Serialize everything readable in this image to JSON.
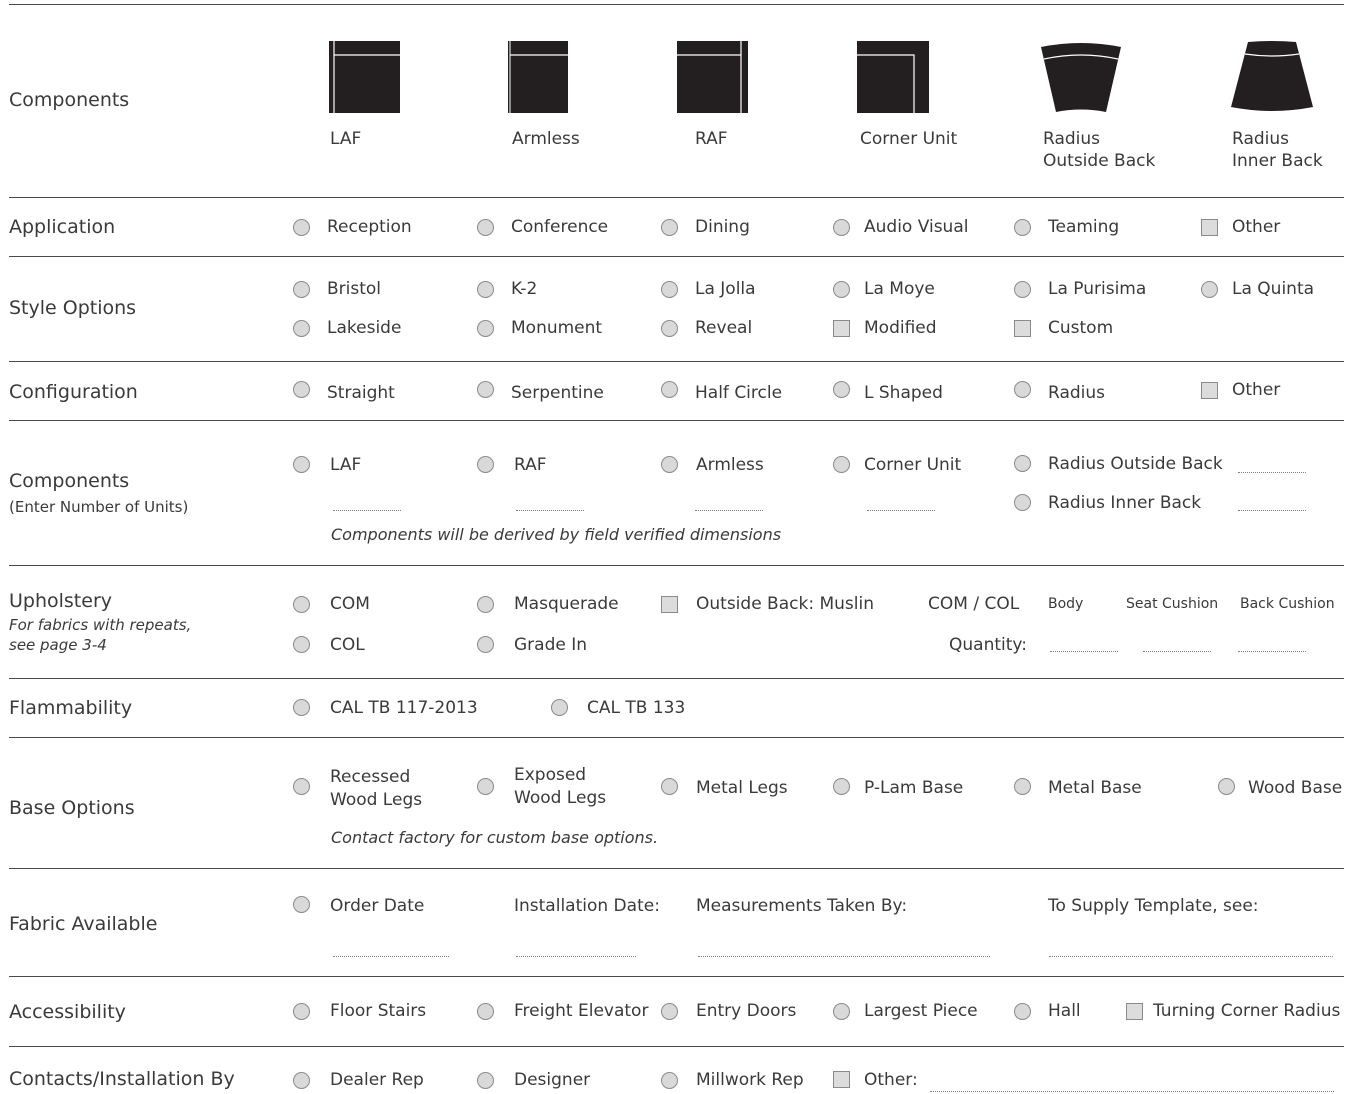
{
  "components_header": {
    "title": "Components",
    "items": [
      {
        "name": "LAF",
        "icon": "laf-icon"
      },
      {
        "name": "Armless",
        "icon": "armless-icon"
      },
      {
        "name": "RAF",
        "icon": "raf-icon"
      },
      {
        "name": "Corner Unit",
        "icon": "corner-unit-icon"
      },
      {
        "name_line1": "Radius",
        "name_line2": "Outside Back",
        "icon": "radius-outside-back-icon"
      },
      {
        "name_line1": "Radius",
        "name_line2": "Inner Back",
        "icon": "radius-inner-back-icon"
      }
    ]
  },
  "application": {
    "label": "Application",
    "options": [
      "Reception",
      "Conference",
      "Dining",
      "Audio Visual",
      "Teaming",
      "Other"
    ]
  },
  "style_options": {
    "label": "Style Options",
    "row1": [
      "Bristol",
      "K-2",
      "La Jolla",
      "La Moye",
      "La Purisima",
      "La Quinta"
    ],
    "row2": [
      "Lakeside",
      "Monument",
      "Reveal",
      "Modified",
      "Custom"
    ]
  },
  "configuration": {
    "label": "Configuration",
    "options": [
      "Straight",
      "Serpentine",
      "Half Circle",
      "L Shaped",
      "Radius",
      "Other"
    ]
  },
  "components_units": {
    "label": "Components",
    "sublabel": "(Enter Number of Units)",
    "options": [
      "LAF",
      "RAF",
      "Armless",
      "Corner Unit",
      "Radius Outside Back",
      "Radius Inner Back"
    ],
    "note": "Components will be derived by field verified dimensions"
  },
  "upholstery": {
    "label": "Upholstery",
    "note_line1": "For fabrics with repeats,",
    "note_line2": "see page 3-4",
    "options": [
      "COM",
      "Masquerade",
      "Outside Back: Muslin",
      "COL",
      "Grade In"
    ],
    "com_col": "COM / COL",
    "quantity": "Quantity:",
    "columns": [
      "Body",
      "Seat Cushion",
      "Back Cushion"
    ]
  },
  "flammability": {
    "label": "Flammability",
    "options": [
      "CAL TB 117-2013",
      "CAL TB 133"
    ]
  },
  "base_options": {
    "label": "Base Options",
    "recessed_line1": "Recessed",
    "recessed_line2": "Wood Legs",
    "exposed_line1": "Exposed",
    "exposed_line2": "Wood Legs",
    "options": [
      "Metal Legs",
      "P-Lam Base",
      "Metal Base",
      "Wood Base"
    ],
    "note": "Contact factory for custom base options."
  },
  "fabric_available": {
    "label": "Fabric Available",
    "fields": [
      "Order Date",
      "Installation Date:",
      "Measurements Taken By:",
      "To Supply Template, see:"
    ]
  },
  "accessibility": {
    "label": "Accessibility",
    "options": [
      "Floor Stairs",
      "Freight Elevator",
      "Entry Doors",
      "Largest Piece",
      "Hall",
      "Turning Corner Radius"
    ]
  },
  "contacts": {
    "label": "Contacts/Installation By",
    "options": [
      "Dealer Rep",
      "Designer",
      "Millwork Rep",
      "Other:"
    ]
  }
}
